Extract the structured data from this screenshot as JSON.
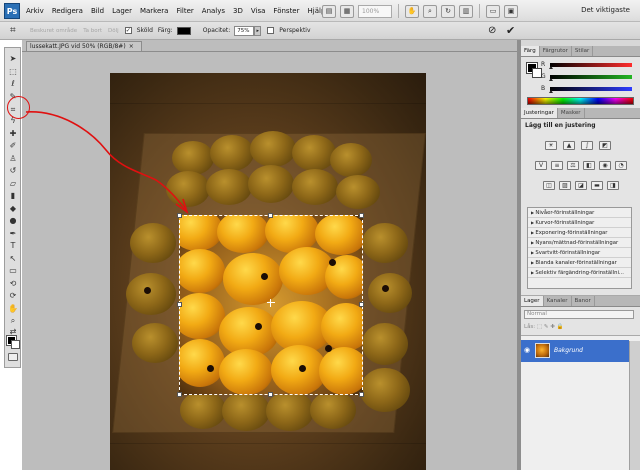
{
  "app": {
    "logo": "Ps",
    "workspace": "Det viktigaste"
  },
  "menu": {
    "items": [
      "Arkiv",
      "Redigera",
      "Bild",
      "Lager",
      "Markera",
      "Filter",
      "Analys",
      "3D",
      "Visa",
      "Fönster",
      "Hjälp"
    ],
    "zoom": "100%"
  },
  "options": {
    "edit_label": "Beskuret område",
    "edit_value": "Ta bort",
    "hide_label": "Dölj",
    "shield_label": "Sköld",
    "color_label": "Färg:",
    "opacity_label": "Opacitet:",
    "opacity_value": "75%",
    "perspective_label": "Perspektiv"
  },
  "document": {
    "tab_title": "lussekatt.JPG vid 50% (RGB/8#)"
  },
  "color_panel": {
    "tabs": [
      "Färg",
      "Färgrutor",
      "Stilar"
    ],
    "channels": [
      "R",
      "G",
      "B"
    ],
    "colors": {
      "r": "#ff2d2d",
      "g": "#23b523",
      "b": "#2e3cff"
    }
  },
  "adjustments": {
    "tabs": [
      "Justeringar",
      "Masker"
    ],
    "title": "Lägg till en justering",
    "presets": [
      "Nivåer-förinställningar",
      "Kurvor-förinställningar",
      "Exponering-förinställningar",
      "Nyans/mättnad-förinställningar",
      "Svartvitt-förinställningar",
      "Blanda kanaler-förinställningar",
      "Selektiv färgändring-förinställni..."
    ]
  },
  "layers": {
    "tabs": [
      "Lager",
      "Kanaler",
      "Banor"
    ],
    "blend_mode": "Normal",
    "lock_label": "Lås:",
    "items": [
      {
        "name": "Bakgrund"
      }
    ]
  },
  "annotation": {
    "color": "#e01010"
  }
}
